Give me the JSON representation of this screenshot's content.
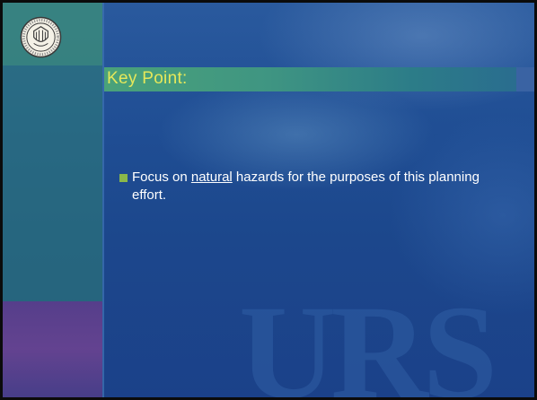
{
  "slide": {
    "title": "Key Point:",
    "bullets": [
      {
        "prefix": "Focus on ",
        "emphasis": "natural",
        "suffix": " hazards for the purposes of this planning effort."
      }
    ],
    "watermark": "URS"
  },
  "colors": {
    "background": "#1f4d93",
    "title_text": "#e6e85a",
    "title_bar": "#3f9582",
    "bullet": "#8ab84a",
    "body_text": "#ffffff"
  },
  "icons": {
    "logo": "seal-logo-icon",
    "bullet": "square-bullet-icon"
  }
}
